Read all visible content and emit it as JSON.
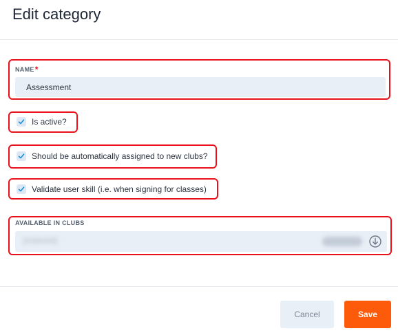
{
  "dialog": {
    "title": "Edit category",
    "name_field": {
      "label": "NAME",
      "required_marker": "*",
      "value": "Assessment"
    },
    "checkboxes": [
      {
        "label": "Is active?",
        "checked": true
      },
      {
        "label": "Should be automatically assigned to new clubs?",
        "checked": true
      },
      {
        "label": "Validate user skill (i.e. when signing for classes)",
        "checked": true
      }
    ],
    "clubs_field": {
      "label": "AVAILABLE IN CLUBS",
      "value": "[redacted]"
    },
    "buttons": {
      "cancel": "Cancel",
      "save": "Save"
    },
    "colors": {
      "highlight": "#e8101a",
      "save_button": "#fd5a0a",
      "input_background": "#e9eff6",
      "check_color": "#1a8fd6"
    },
    "icons": {
      "checkbox_check": "check-icon",
      "select_dropdown": "circle-arrow-down-icon"
    }
  }
}
